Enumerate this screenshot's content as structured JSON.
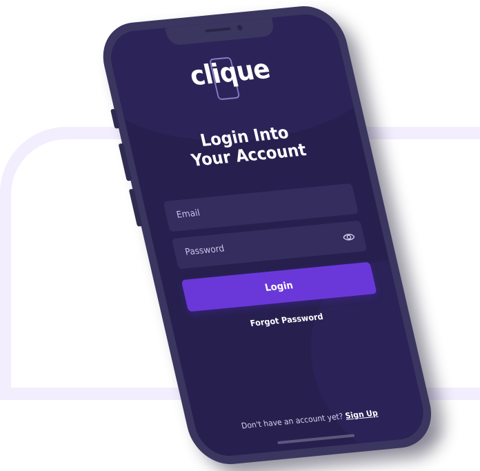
{
  "app": {
    "logo_text": "clique"
  },
  "login": {
    "title_line1": "Login Into",
    "title_line2": "Your Account",
    "email_placeholder": "Email",
    "password_placeholder": "Password",
    "password_toggle_icon": "eye-icon",
    "login_label": "Login",
    "forgot_label": "Forgot Password",
    "signup_prompt": "Don't have an account yet?",
    "signup_label": "Sign Up"
  },
  "colors": {
    "screen_background": "#27204f",
    "input_background": "#342d5e",
    "accent": "#6a38d9",
    "phone_frame": "#3b3660",
    "background_frame": "#f2eefe"
  }
}
